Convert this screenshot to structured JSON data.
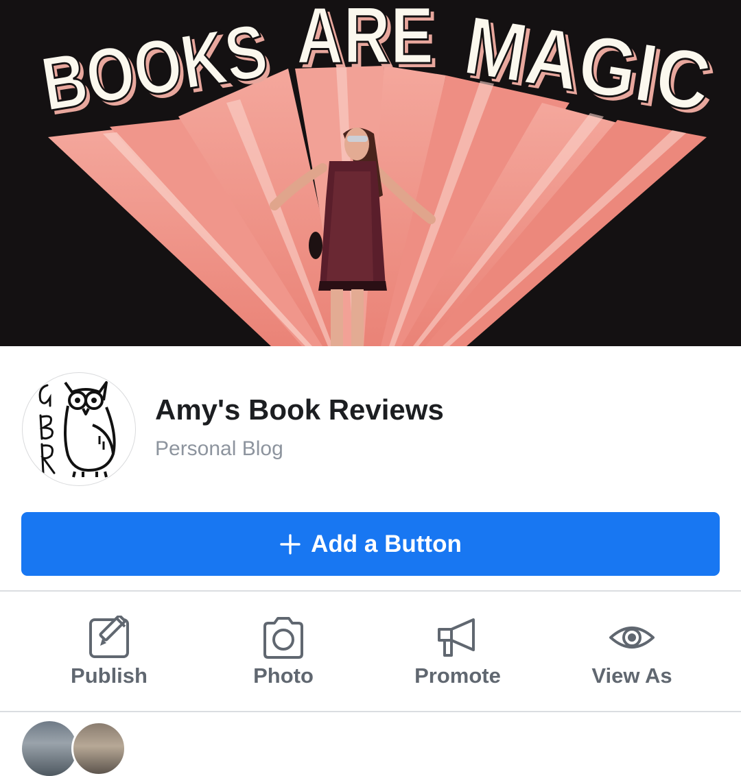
{
  "cover": {
    "mural_text": "BOOKS ARE MAGIC",
    "colors": {
      "background": "#141112",
      "rays": "#ef8f86",
      "ray_highlight": "#f8c9bf",
      "letters": "#fbf8ee",
      "letter_shadow": "#e8a79d"
    }
  },
  "profile": {
    "avatar_monogram": "ABR",
    "name": "Amy's Book Reviews",
    "category": "Personal Blog"
  },
  "primary_button": {
    "label": "Add a Button",
    "color": "#1877f2"
  },
  "actions": [
    {
      "id": "publish",
      "label": "Publish",
      "icon": "compose-icon"
    },
    {
      "id": "photo",
      "label": "Photo",
      "icon": "camera-icon"
    },
    {
      "id": "promote",
      "label": "Promote",
      "icon": "megaphone-icon"
    },
    {
      "id": "view_as",
      "label": "View As",
      "icon": "eye-icon"
    }
  ],
  "theme": {
    "text_primary": "#1c1e21",
    "text_secondary": "#8d949e",
    "icon_gray": "#606770",
    "divider": "#dadde1"
  }
}
